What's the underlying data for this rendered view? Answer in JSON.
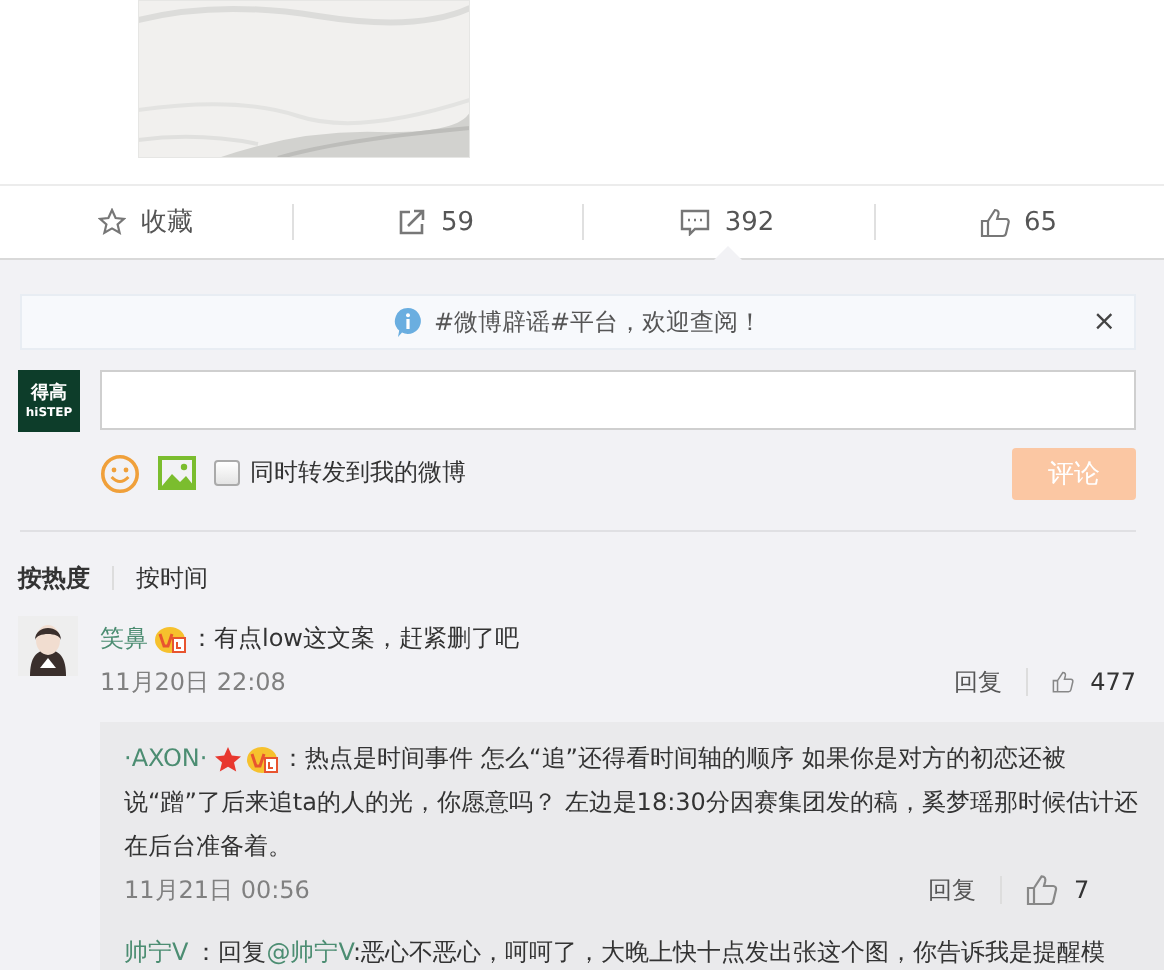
{
  "actions": [
    {
      "kind": "favorite",
      "label": "收藏",
      "selected": false
    },
    {
      "kind": "repost",
      "label": "59",
      "selected": false
    },
    {
      "kind": "comment",
      "label": "392",
      "selected": true
    },
    {
      "kind": "like",
      "label": "65",
      "selected": false
    }
  ],
  "notice": {
    "text": "#微博辟谣#平台，欢迎查阅！",
    "close": "×"
  },
  "composer": {
    "avatar_top": "得高",
    "avatar_bottom": "hiSTEP",
    "also_repost": {
      "label": "同时转发到我的微博",
      "checked": false
    },
    "submit": {
      "label": "评论",
      "disabled": true
    }
  },
  "sort_tabs": [
    {
      "label": "按热度",
      "selected": true
    },
    {
      "label": "按时间",
      "selected": false
    }
  ],
  "comments": [
    {
      "name": "笑鼻",
      "star": false,
      "vip": true,
      "text": [
        "：有点low这文案，赶紧删了吧"
      ],
      "time": "11月20日 22:08",
      "reply": "回复",
      "likes": "477",
      "replies": [
        {
          "name": "·AXON·",
          "star": true,
          "vip": true,
          "text": [
            "：热点是时间事件 怎么“追”还得看时间轴的顺序 如果你是对方的初恋还被",
            "说“蹭”了后来追ta的人的光，你愿意吗？ 左边是18:30分因赛集团发的稿，奚梦瑶那时候估计还",
            "在后台准备着。"
          ],
          "time": "11月21日 00:56",
          "reply": "回复",
          "likes": "7"
        },
        {
          "name": "帅宁V",
          "star": false,
          "vip": false,
          "prefix": "：回复",
          "mention": "@帅宁V",
          "text": [
            ":恶心不恶心，呵呵了，大晚上快十点发出张这个图，你告诉我是提醒模"
          ]
        }
      ]
    }
  ]
}
